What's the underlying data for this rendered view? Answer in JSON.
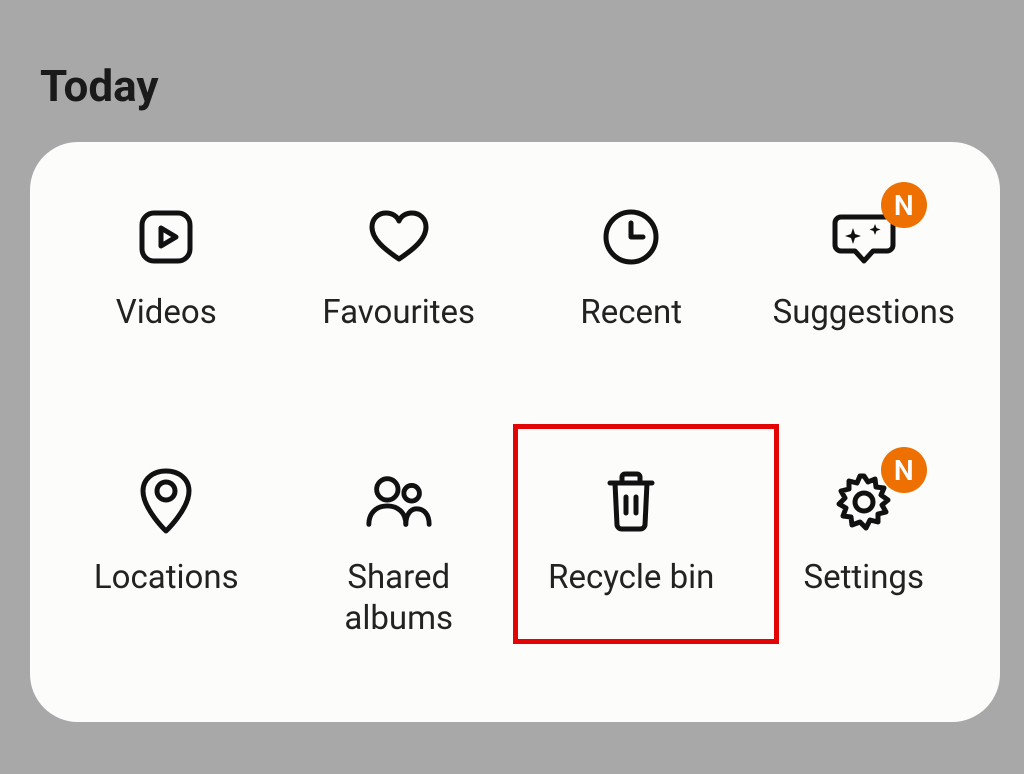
{
  "header": {
    "title": "Today"
  },
  "tiles": {
    "videos": {
      "label": "Videos",
      "icon": "play-square-icon",
      "badge": null
    },
    "favourites": {
      "label": "Favourites",
      "icon": "heart-icon",
      "badge": null
    },
    "recent": {
      "label": "Recent",
      "icon": "clock-icon",
      "badge": null
    },
    "suggestions": {
      "label": "Suggestions",
      "icon": "sparkle-chat-icon",
      "badge": "N"
    },
    "locations": {
      "label": "Locations",
      "icon": "pin-icon",
      "badge": null
    },
    "shared": {
      "label": "Shared albums",
      "icon": "people-icon",
      "badge": null
    },
    "recycle": {
      "label": "Recycle bin",
      "icon": "trash-icon",
      "badge": null
    },
    "settings": {
      "label": "Settings",
      "icon": "gear-icon",
      "badge": "N"
    }
  },
  "highlight": {
    "target": "recycle"
  },
  "colors": {
    "badge": "#ed7001",
    "highlight": "#e30505"
  }
}
